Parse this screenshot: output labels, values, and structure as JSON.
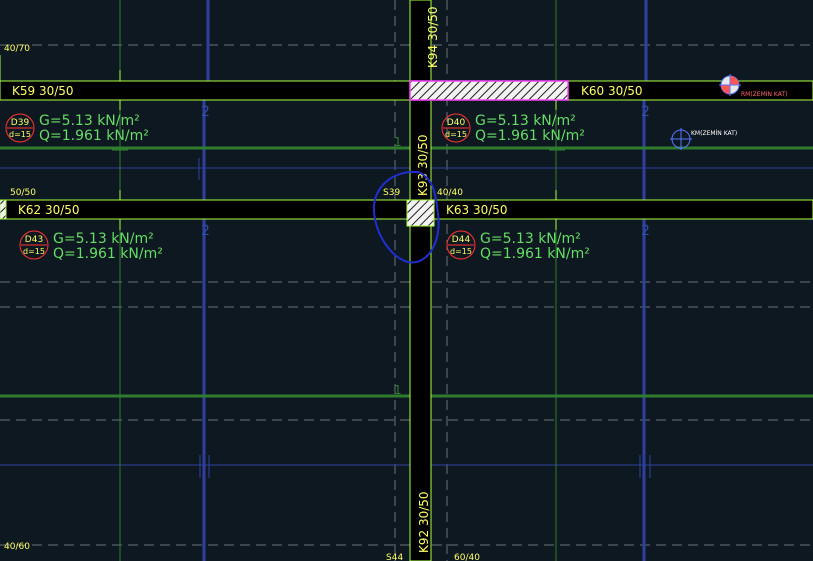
{
  "beams": {
    "k59": "K59 30/50",
    "k60": "K60 30/50",
    "k62": "K62 30/50",
    "k63": "K63 30/50",
    "k94": "K94 30/50",
    "k93": "K93 30/50",
    "k92": "K92 30/50"
  },
  "columns": {
    "s39": "S39",
    "s44": "S44",
    "c_40_70": "40/70",
    "c_50_50": "50/50",
    "c_40_40": "40/40",
    "c_40_60": "40/60",
    "c_60_40": "60/40"
  },
  "slabs": [
    {
      "id": "D39",
      "d": "d=15",
      "g": "G=5.13 kN/m²",
      "q": "Q=1.961 kN/m²"
    },
    {
      "id": "D40",
      "d": "d=15",
      "g": "G=5.13 kN/m²",
      "q": "Q=1.961 kN/m²"
    },
    {
      "id": "D43",
      "d": "d=15",
      "g": "G=5.13 kN/m²",
      "q": "Q=1.961 kN/m²"
    },
    {
      "id": "D44",
      "d": "d=15",
      "g": "G=5.13 kN/m²",
      "q": "Q=1.961 kN/m²"
    }
  ],
  "axis_labels": {
    "two": "2",
    "one": "1"
  },
  "markers": {
    "rm": "RM(ZEMİN KAT)",
    "km": "KM(ZEMİN KAT)"
  },
  "colors": {
    "background": "#0d1820",
    "beam_outline": "#aaff44",
    "beam_text": "#ffff66",
    "load_text": "#66dd66",
    "grid_blue": "#2f3f9f",
    "grid_green": "#2e7d2e",
    "slab_circle": "#ff3333",
    "highlight_stroke": "#1f2fd0",
    "hatch_stroke": "#ff44ff"
  }
}
